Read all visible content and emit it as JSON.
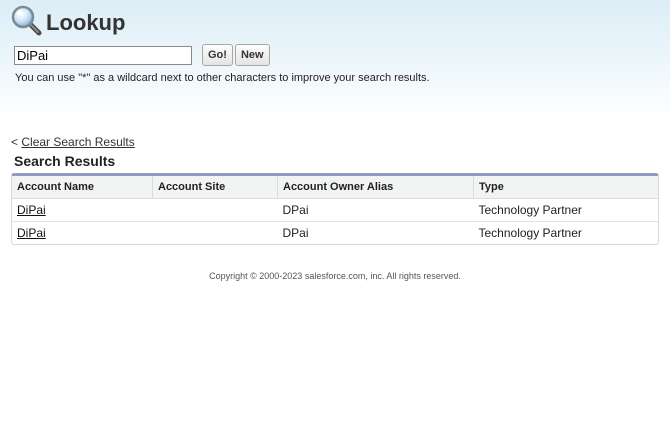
{
  "header": {
    "title": "Lookup",
    "icon": "magnifier-icon"
  },
  "search": {
    "value": "DiPai",
    "go_label": "Go!",
    "new_label": "New"
  },
  "hint": "You can use \"*\" as a wildcard next to other characters to improve your search results.",
  "clear": {
    "prefix": "<",
    "link_label": "Clear Search Results"
  },
  "results": {
    "heading": "Search Results",
    "columns": [
      "Account Name",
      "Account Site",
      "Account Owner Alias",
      "Type"
    ],
    "rows": [
      {
        "account_name": "DiPai",
        "account_site": "",
        "owner_alias": "DPai",
        "type": "Technology Partner"
      },
      {
        "account_name": "DiPai",
        "account_site": "",
        "owner_alias": "DPai",
        "type": "Technology Partner"
      }
    ]
  },
  "footer": "Copyright © 2000-2023 salesforce.com, inc. All rights reserved.",
  "colors": {
    "table_accent": "#8e9dbe",
    "header_bg": "#dcedf6"
  }
}
